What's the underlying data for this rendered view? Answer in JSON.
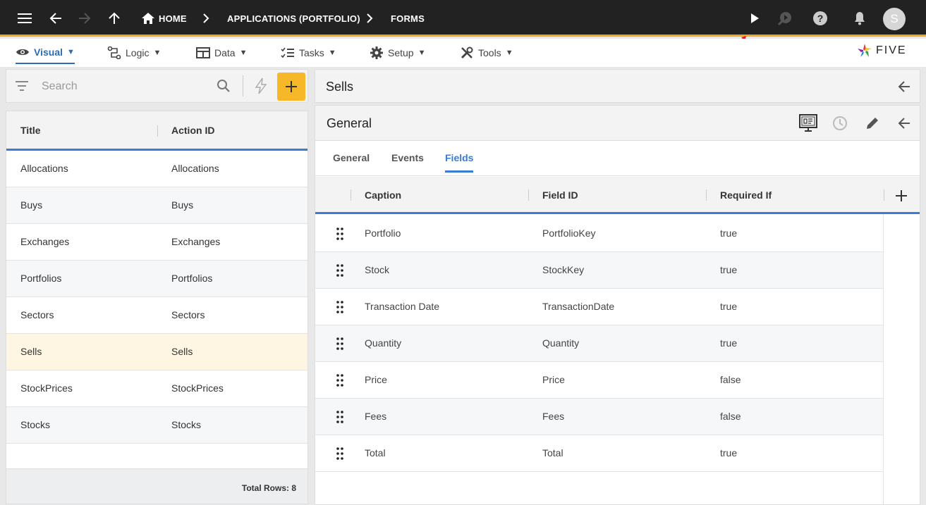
{
  "breadcrumbs": [
    "HOME",
    "APPLICATIONS (PORTFOLIO)",
    "FORMS"
  ],
  "avatar_initial": "S",
  "menus": [
    {
      "label": "Visual",
      "caret": "▼"
    },
    {
      "label": "Logic",
      "caret": "▼"
    },
    {
      "label": "Data",
      "caret": "▼"
    },
    {
      "label": "Tasks",
      "caret": "▼"
    },
    {
      "label": "Setup",
      "caret": "▼"
    },
    {
      "label": "Tools",
      "caret": "▼"
    }
  ],
  "logo_text": "FIVE",
  "search": {
    "placeholder": "Search"
  },
  "list": {
    "columns": [
      "Title",
      "Action ID"
    ],
    "rows": [
      {
        "title": "Allocations",
        "action_id": "Allocations"
      },
      {
        "title": "Buys",
        "action_id": "Buys"
      },
      {
        "title": "Exchanges",
        "action_id": "Exchanges"
      },
      {
        "title": "Portfolios",
        "action_id": "Portfolios"
      },
      {
        "title": "Sectors",
        "action_id": "Sectors"
      },
      {
        "title": "Sells",
        "action_id": "Sells"
      },
      {
        "title": "StockPrices",
        "action_id": "StockPrices"
      },
      {
        "title": "Stocks",
        "action_id": "Stocks"
      }
    ],
    "total_rows": "Total Rows: 8"
  },
  "detail": {
    "title": "Sells",
    "form_title": "General",
    "tabs": [
      "General",
      "Events",
      "Fields"
    ],
    "active_tab": "Fields",
    "columns": [
      "Caption",
      "Field ID",
      "Required If"
    ],
    "rows": [
      {
        "caption": "Portfolio",
        "field_id": "PortfolioKey",
        "required_if": "true"
      },
      {
        "caption": "Stock",
        "field_id": "StockKey",
        "required_if": "true"
      },
      {
        "caption": "Transaction Date",
        "field_id": "TransactionDate",
        "required_if": "true"
      },
      {
        "caption": "Quantity",
        "field_id": "Quantity",
        "required_if": "true"
      },
      {
        "caption": "Price",
        "field_id": "Price",
        "required_if": "false"
      },
      {
        "caption": "Fees",
        "field_id": "Fees",
        "required_if": "false"
      },
      {
        "caption": "Total",
        "field_id": "Total",
        "required_if": "true"
      }
    ]
  },
  "colors": {
    "accent": "#3a7bd5",
    "topbar": "#222222",
    "topbar_border": "#f0a81c",
    "add_button": "#f6b728",
    "selected_row": "#fef5e3"
  }
}
